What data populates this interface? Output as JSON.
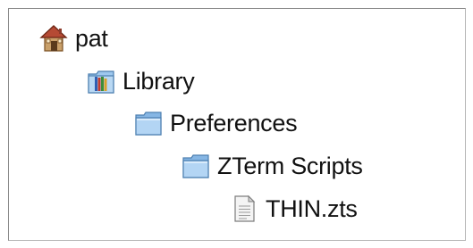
{
  "tree": {
    "items": [
      {
        "label": "pat",
        "icon": "home-icon"
      },
      {
        "label": "Library",
        "icon": "library-folder-icon"
      },
      {
        "label": "Preferences",
        "icon": "folder-icon"
      },
      {
        "label": "ZTerm Scripts",
        "icon": "folder-icon"
      },
      {
        "label": "THIN.zts",
        "icon": "document-icon"
      }
    ]
  },
  "colors": {
    "folder": "#9ec8ee",
    "folder_dark": "#5b93c8",
    "border": "#8a8a8a",
    "text": "#111111"
  }
}
